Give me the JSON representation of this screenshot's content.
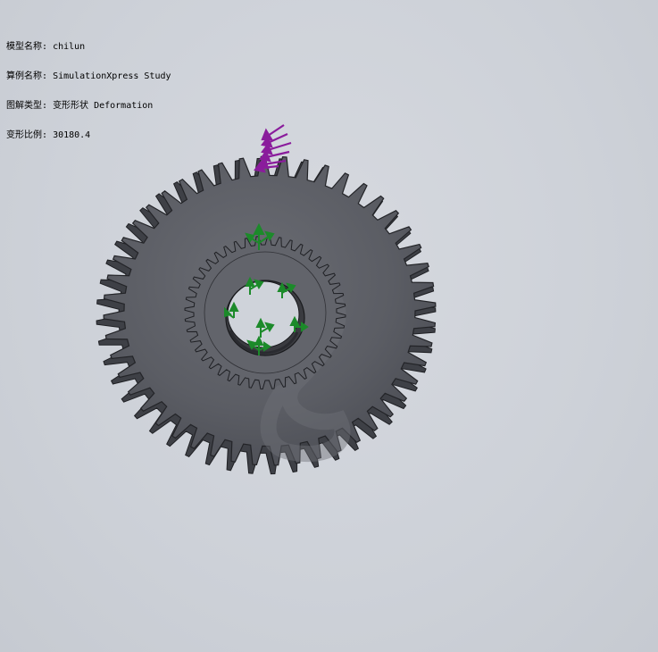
{
  "info": {
    "model_name_label": "模型名称:",
    "model_name_value": "chilun",
    "study_name_label": "算例名称:",
    "study_name_value": "SimulationXpress Study",
    "plot_type_label": "图解类型:",
    "plot_type_value": "变形形状 Deformation",
    "deformation_scale_label": "变形比例:",
    "deformation_scale_value": "30180.4"
  },
  "icons": {
    "force_arrow": "force-arrow-icon",
    "fixture_arrow": "fixture-arrow-icon"
  },
  "colors": {
    "background": "#cfd3da",
    "gear_body": "#5d5f66",
    "gear_edge": "#2a2b2f",
    "gear_highlight": "#6c6e75",
    "gear_shadow": "#4e5057",
    "load_arrows": "#8a1c9c",
    "fixture_arrows": "#1c8a2a"
  }
}
